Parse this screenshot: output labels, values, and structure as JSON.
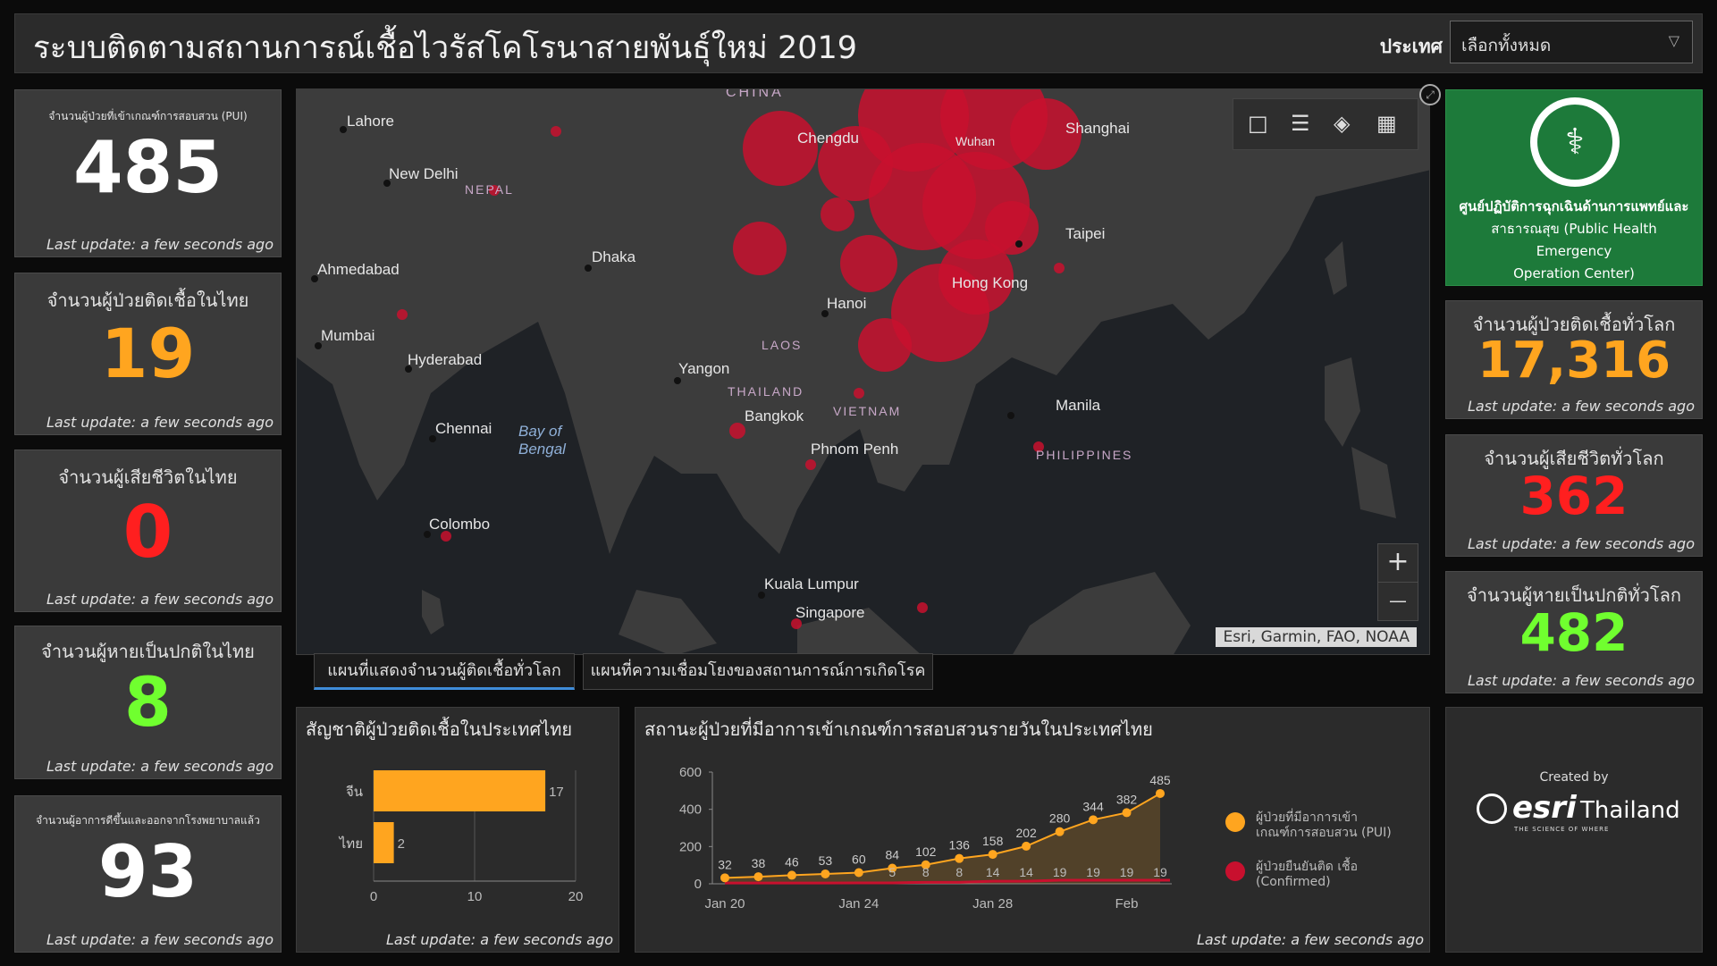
{
  "header": {
    "title": "ระบบติดตามสถานการณ์เชื้อไวรัสโคโรนาสายพันธุ์ใหม่ 2019",
    "country_label": "ประเทศ",
    "country_value": "เลือกทั้งหมด"
  },
  "colors": {
    "accent_orange": "#ffa51f",
    "accent_red": "#ff1f1f",
    "accent_green": "#70ff2f",
    "white": "#ffffff",
    "map_bubble": "#c8102e",
    "moph_green": "#1d7a3a"
  },
  "left_cards": [
    {
      "label": "จำนวนผู้ป่วยที่เข้าเกณฑ์การสอบสวน (PUI)",
      "value": "485",
      "update": "Last update: a few seconds ago",
      "color": "#ffffff"
    },
    {
      "label": "จำนวนผู้ป่วยติดเชื้อในไทย",
      "value": "19",
      "update": "Last update: a few seconds ago",
      "color": "#ffa51f"
    },
    {
      "label": "จำนวนผู้เสียชีวิตในไทย",
      "value": "0",
      "update": "Last update: a few seconds ago",
      "color": "#ff1f1f"
    },
    {
      "label": "จำนวนผู้หายเป็นปกติในไทย",
      "value": "8",
      "update": "Last update: a few seconds ago",
      "color": "#70ff2f"
    },
    {
      "label": "จำนวนผู้อาการดีขึ้นและออกจากโรงพยาบาลแล้ว",
      "value": "93",
      "update": "Last update: a few seconds ago",
      "color": "#ffffff"
    }
  ],
  "right_cards": [
    {
      "label": "จำนวนผู้ป่วยติดเชื้อทั่วโลก",
      "value": "17,316",
      "update": "Last update: a few seconds ago",
      "color": "#ffa51f"
    },
    {
      "label": "จำนวนผู้เสียชีวิตทั่วโลก",
      "value": "362",
      "update": "Last update: a few seconds ago",
      "color": "#ff1f1f"
    },
    {
      "label": "จำนวนผู้หายเป็นปกติทั่วโลก",
      "value": "482",
      "update": "Last update: a few seconds ago",
      "color": "#70ff2f"
    }
  ],
  "moph": {
    "line1": "ศูนย์ปฏิบัติการฉุกเฉินด้านการแพทย์และ",
    "line2": "สาธารณสุข (Public Health Emergency",
    "line3": "Operation Center)"
  },
  "map": {
    "attribution": "Esri, Garmin, FAO, NOAA",
    "labels": [
      "CHINA",
      "Lahore",
      "New Delhi",
      "NEPAL",
      "Ahmedabad",
      "Mumbai",
      "Hyderabad",
      "Dhaka",
      "Chennai",
      "Bay of",
      "Bengal",
      "Colombo",
      "Chengdu",
      "Wuhan",
      "Shanghai",
      "Taipei",
      "Hong Kong",
      "Hanoi",
      "LAOS",
      "Yangon",
      "THAILAND",
      "Bangkok",
      "VIETNAM",
      "Phnom Penh",
      "Manila",
      "PHILIPPINES",
      "Kuala Lumpur",
      "Singapore"
    ],
    "tool_icons": [
      "bookmark-icon",
      "list-icon",
      "layers-icon",
      "grid-icon"
    ],
    "zoom_in": "+",
    "zoom_out": "—"
  },
  "tabs": [
    {
      "label": "แผนที่แสดงจำนวนผู้ติดเชื้อทั่วโลก",
      "active": true
    },
    {
      "label": "แผนที่ความเชื่อมโยงของสถานการณ์การเกิดโรค",
      "active": false
    }
  ],
  "nationality_panel": {
    "title": "สัญชาติผู้ป่วยติดเชื้อในประเทศไทย",
    "update": "Last update: a few seconds ago"
  },
  "daily_panel": {
    "title": "สถานะผู้ป่วยที่มีอาการเข้าเกณฑ์การสอบสวนรายวันในประเทศไทย",
    "update": "Last update: a few seconds ago",
    "legend": [
      {
        "line1": "ผู้ป่วยที่มีอาการเข้า",
        "line2": "เกณฑ์การสอบสวน (PUI)",
        "color": "#ffa51f"
      },
      {
        "line1": "ผู้ป่วยยืนยันติด เชื้อ",
        "line2": "(Confirmed)",
        "color": "#c8102e"
      }
    ]
  },
  "esri": {
    "created_by": "Created by",
    "brand": "esri",
    "region": "Thailand",
    "tagline": "THE SCIENCE OF WHERE"
  },
  "chart_data": [
    {
      "type": "bar",
      "orientation": "horizontal",
      "categories": [
        "จีน",
        "ไทย"
      ],
      "values": [
        17,
        2
      ],
      "xlim": [
        0,
        20
      ],
      "xticks": [
        0,
        10,
        20
      ],
      "color": "#ffa51f"
    },
    {
      "type": "area",
      "x_tick_labels": [
        "Jan 20",
        "Jan 24",
        "Jan 28",
        "Feb"
      ],
      "ylim": [
        0,
        600
      ],
      "yticks": [
        0,
        200,
        400,
        600
      ],
      "series": [
        {
          "name": "ผู้ป่วยที่มีอาการเข้าเกณฑ์การสอบสวน (PUI)",
          "color": "#ffa51f",
          "values": [
            32,
            38,
            46,
            53,
            60,
            84,
            102,
            136,
            158,
            202,
            280,
            344,
            382,
            485
          ]
        },
        {
          "name": "ผู้ป่วยยืนยันติด เชื้อ (Confirmed)",
          "color": "#c8102e",
          "values": [
            4,
            4,
            4,
            4,
            5,
            5,
            8,
            8,
            14,
            14,
            19,
            19,
            19,
            19
          ],
          "shown_labels": [
            "",
            "",
            "",
            "",
            "",
            "5",
            "8",
            "8",
            "14",
            "14",
            "19",
            "19",
            "19",
            "19"
          ]
        }
      ]
    }
  ]
}
